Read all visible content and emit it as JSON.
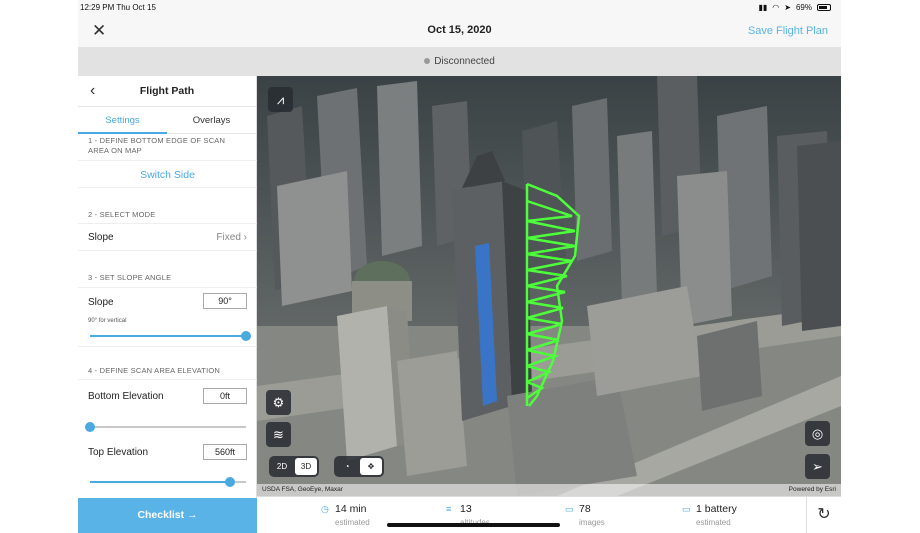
{
  "status_bar": {
    "time_date": "12:29 PM  Thu Oct 15",
    "battery": "69%"
  },
  "header": {
    "close_icon": "close-icon",
    "title": "Oct 15, 2020",
    "save_label": "Save Flight Plan"
  },
  "connection": {
    "status": "Disconnected"
  },
  "sidebar": {
    "title": "Flight Path",
    "tabs": [
      {
        "label": "Settings",
        "active": true
      },
      {
        "label": "Overlays",
        "active": false
      }
    ],
    "step1": "1 - DEFINE BOTTOM EDGE OF SCAN AREA ON MAP",
    "switch_side": "Switch Side",
    "step2": "2 - SELECT MODE",
    "mode": {
      "label": "Slope",
      "value": "Fixed"
    },
    "step3": "3 - SET SLOPE ANGLE",
    "slope": {
      "label": "Slope",
      "value": "90°",
      "hint": "90° for vertical",
      "level": 1.0
    },
    "step4": "4 - DEFINE SCAN AREA ELEVATION",
    "bottom_elevation": {
      "label": "Bottom Elevation",
      "value": "0ft",
      "level": 0.0
    },
    "top_elevation": {
      "label": "Top Elevation",
      "value": "560ft",
      "level": 0.9
    },
    "checklist": "Checklist →"
  },
  "map": {
    "seg_2d": "2D",
    "seg_3d": "3D",
    "selected_view": "3D",
    "attribution_left": "USDA FSA, GeoEye, Maxar",
    "attribution_right": "Powered by Esri",
    "flight_path_color": "#4dff3a"
  },
  "stats": [
    {
      "icon": "clock-icon",
      "value": "14 min",
      "sub": "estimated"
    },
    {
      "icon": "altitudes-icon",
      "value": "13",
      "sub": "altitudes"
    },
    {
      "icon": "images-icon",
      "value": "78",
      "sub": "images"
    },
    {
      "icon": "battery-icon",
      "value": "1 battery",
      "sub": "estimated"
    }
  ]
}
